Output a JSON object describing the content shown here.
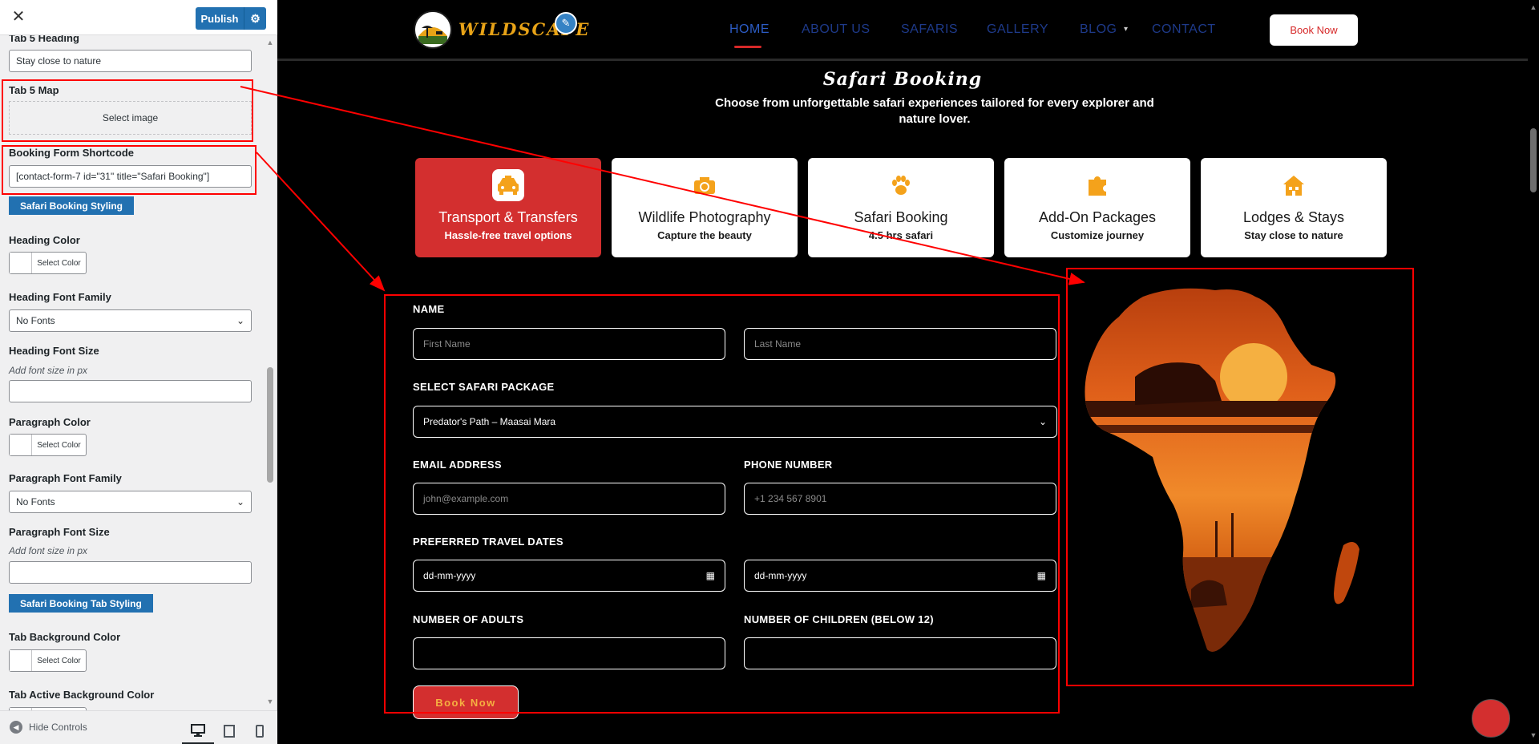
{
  "customizer": {
    "close_label": "✕",
    "publish_label": "Publish",
    "gear_icon": "gear-icon",
    "tab5_heading_label": "Tab 5 Heading",
    "tab5_heading_value": "Stay close to nature",
    "tab5_map_label": "Tab 5 Map",
    "select_image_label": "Select image",
    "shortcode_label": "Booking Form Shortcode",
    "shortcode_value": "[contact-form-7 id=\"31\" title=\"Safari Booking\"]",
    "styling_section": "Safari Booking Styling",
    "heading_color_label": "Heading Color",
    "select_color": "Select Color",
    "heading_font_family_label": "Heading Font Family",
    "no_fonts": "No Fonts",
    "heading_font_size_label": "Heading Font Size",
    "font_size_desc": "Add font size in px",
    "paragraph_color_label": "Paragraph Color",
    "paragraph_font_family_label": "Paragraph Font Family",
    "paragraph_font_size_label": "Paragraph Font Size",
    "tab_styling_section": "Safari Booking Tab Styling",
    "tab_bg_color_label": "Tab Background Color",
    "tab_active_bg_label": "Tab Active Background Color",
    "hide_controls": "Hide Controls"
  },
  "site": {
    "brand": "WILDSCAPE",
    "nav": [
      "HOME",
      "ABOUT US",
      "SAFARIS",
      "GALLERY",
      "BLOG",
      "CONTACT"
    ],
    "book_now": "Book Now",
    "section_title": "Safari Booking",
    "section_subtitle": "Choose from unforgettable safari experiences tailored for every explorer and nature lover."
  },
  "tabs": [
    {
      "title": "Transport & Transfers",
      "subtitle": "Hassle-free travel options",
      "icon": "taxi-icon",
      "active": true
    },
    {
      "title": "Wildlife Photography",
      "subtitle": "Capture the beauty",
      "icon": "camera-icon",
      "active": false
    },
    {
      "title": "Safari Booking",
      "subtitle": "4.5 hrs safari",
      "icon": "paw-icon",
      "active": false
    },
    {
      "title": "Add-On Packages",
      "subtitle": "Customize journey",
      "icon": "puzzle-icon",
      "active": false
    },
    {
      "title": "Lodges & Stays",
      "subtitle": "Stay close to nature",
      "icon": "lodge-icon",
      "active": false
    }
  ],
  "form": {
    "name_label": "NAME",
    "first_name_ph": "First Name",
    "last_name_ph": "Last Name",
    "package_label": "SELECT SAFARI PACKAGE",
    "package_value": "Predator's Path – Maasai Mara",
    "email_label": "EMAIL ADDRESS",
    "email_ph": "john@example.com",
    "phone_label": "PHONE NUMBER",
    "phone_ph": "+1 234 567 8901",
    "dates_label": "PREFERRED TRAVEL DATES",
    "date_ph": "dd-mm-yyyy",
    "adults_label": "NUMBER OF ADULTS",
    "children_label": "NUMBER OF CHILDREN (BELOW 12)",
    "submit": "Book Now"
  },
  "colors": {
    "accent_red": "#d32f2f",
    "wp_blue": "#2271b1",
    "logo_gold": "#e8a317",
    "annotation_red": "#ff0000"
  }
}
